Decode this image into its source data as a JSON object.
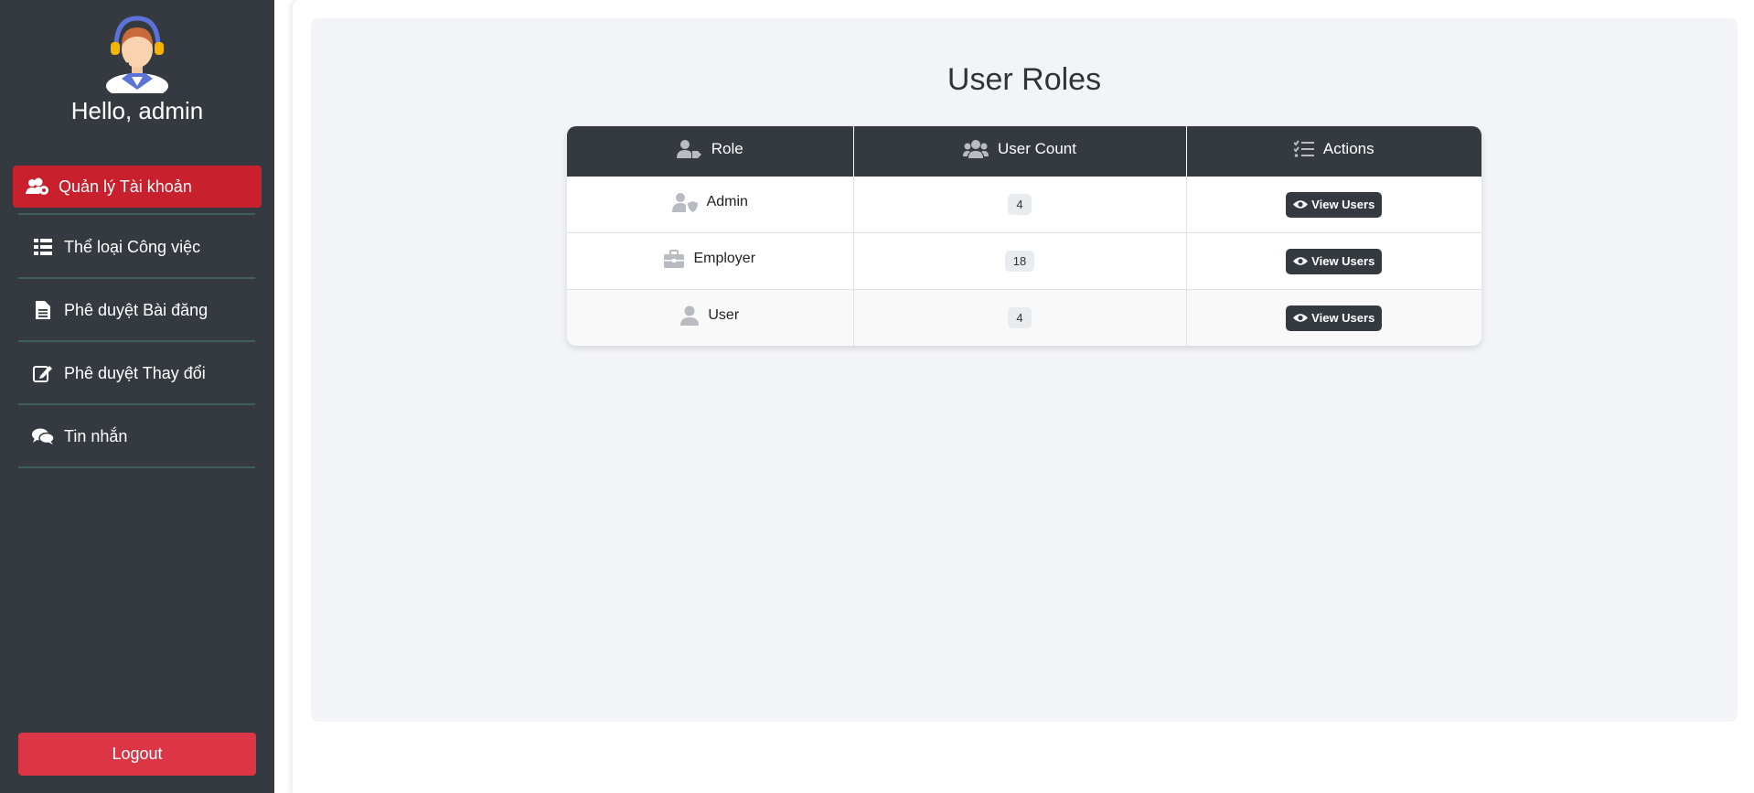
{
  "sidebar": {
    "greeting": "Hello, admin",
    "items": [
      {
        "label": "Quản lý Tài khoản",
        "icon": "users-cog-icon",
        "active": true
      },
      {
        "label": "Thể loại Công việc",
        "icon": "list-icon",
        "active": false
      },
      {
        "label": "Phê duyệt Bài đăng",
        "icon": "file-icon",
        "active": false
      },
      {
        "label": "Phê duyệt Thay đổi",
        "icon": "edit-icon",
        "active": false
      },
      {
        "label": "Tin nhắn",
        "icon": "comments-icon",
        "active": false
      }
    ],
    "logout_label": "Logout"
  },
  "main": {
    "title": "User Roles",
    "table": {
      "headers": [
        {
          "label": "Role",
          "icon": "user-tag-icon"
        },
        {
          "label": "User Count",
          "icon": "users-icon"
        },
        {
          "label": "Actions",
          "icon": "tasks-icon"
        }
      ],
      "rows": [
        {
          "role": "Admin",
          "icon": "user-shield-icon",
          "count": "4",
          "action": "View Users"
        },
        {
          "role": "Employer",
          "icon": "briefcase-icon",
          "count": "18",
          "action": "View Users"
        },
        {
          "role": "User",
          "icon": "user-icon",
          "count": "4",
          "action": "View Users"
        }
      ]
    }
  },
  "colors": {
    "sidebar_bg": "#343a40",
    "active_item": "#c9202d",
    "logout": "#dc3545",
    "panel_bg": "#f3f4f8",
    "table_header": "#343a40"
  }
}
